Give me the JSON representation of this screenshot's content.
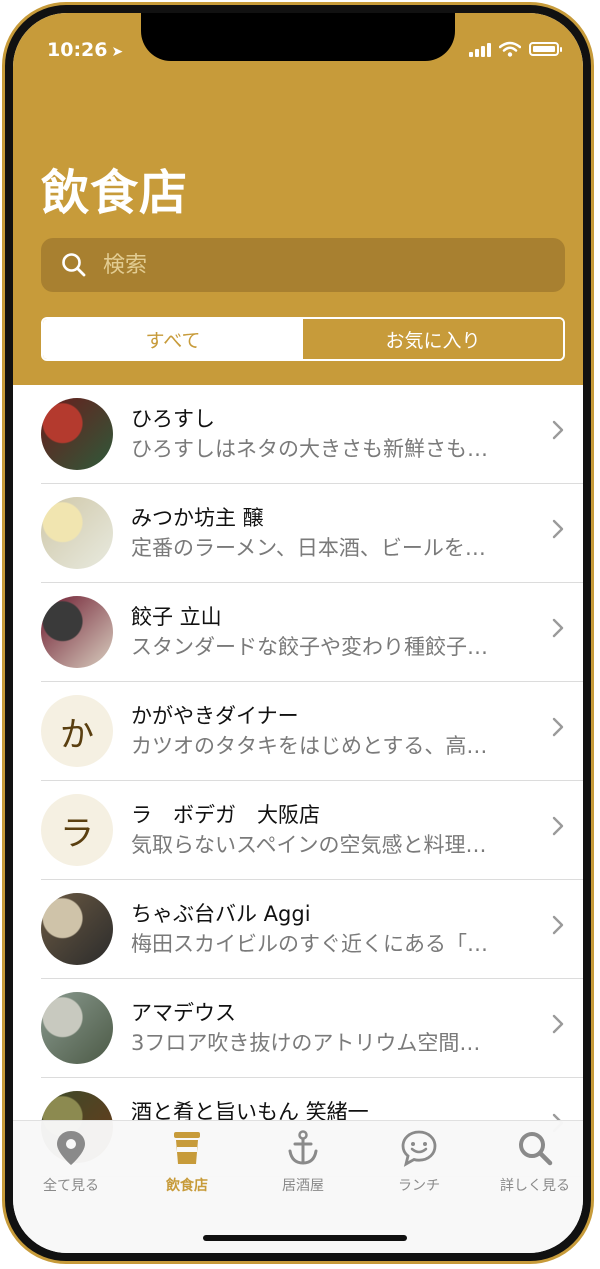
{
  "status": {
    "time": "10:26"
  },
  "header": {
    "title": "飲食店"
  },
  "search": {
    "placeholder": "検索"
  },
  "segments": {
    "all": "すべて",
    "favorites": "お気に入り"
  },
  "restaurants": [
    {
      "name": "ひろすし",
      "desc": "ひろすしはネタの大きさも新鮮さも…",
      "avatar": "photo",
      "letter": ""
    },
    {
      "name": "みつか坊主 醸",
      "desc": "定番のラーメン、日本酒、ビールを…",
      "avatar": "photo",
      "letter": ""
    },
    {
      "name": "餃子 立山",
      "desc": "スタンダードな餃子や変わり種餃子…",
      "avatar": "photo",
      "letter": ""
    },
    {
      "name": "かがやきダイナー",
      "desc": "カツオのタタキをはじめとする、高…",
      "avatar": "letter",
      "letter": "か"
    },
    {
      "name": "ラ　ボデガ　大阪店",
      "desc": "気取らないスペインの空気感と料理…",
      "avatar": "letter",
      "letter": "ラ"
    },
    {
      "name": "ちゃぶ台バル Aggi",
      "desc": "梅田スカイビルのすぐ近くにある「…",
      "avatar": "photo",
      "letter": ""
    },
    {
      "name": "アマデウス",
      "desc": "3フロア吹き抜けのアトリウム空間…",
      "avatar": "photo",
      "letter": ""
    },
    {
      "name": "酒と肴と旨いもん 笑緒一",
      "desc": "",
      "avatar": "photo",
      "letter": ""
    }
  ],
  "tabs": [
    {
      "label": "全て見る",
      "icon": "map-pin-icon"
    },
    {
      "label": "飲食店",
      "icon": "cup-icon"
    },
    {
      "label": "居酒屋",
      "icon": "anchor-icon"
    },
    {
      "label": "ランチ",
      "icon": "chat-bubble-icon"
    },
    {
      "label": "詳しく見る",
      "icon": "search-icon"
    }
  ],
  "colors": {
    "accent": "#c79b3a",
    "search_bg": "#a88030",
    "avatar_letter_bg": "#f5f0e2"
  }
}
